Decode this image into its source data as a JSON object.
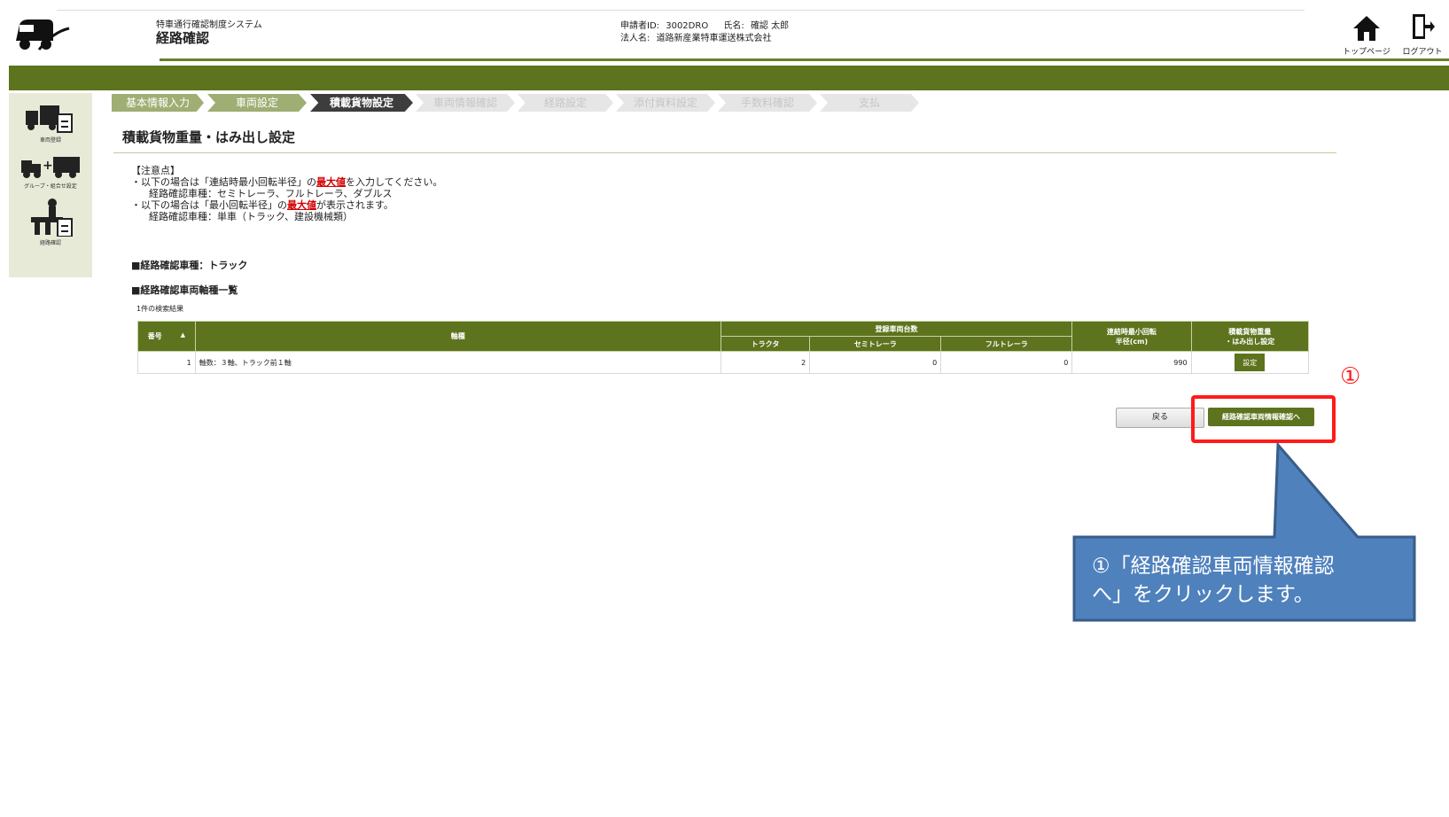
{
  "header": {
    "system_name": "特車通行確認制度システム",
    "page_name": "経路確認",
    "applicant_id_label": "申請者ID:",
    "applicant_id": "3002DRO",
    "name_label": "氏名:",
    "name": "確認 太郎",
    "company_label": "法人名:",
    "company": "道路新産業特車運送株式会社",
    "top_page_label": "トップページ",
    "logout_label": "ログアウト"
  },
  "sidebar": {
    "items": [
      {
        "label": "車両登録"
      },
      {
        "label": "グループ・組合せ設定"
      },
      {
        "label": "経路確認"
      }
    ]
  },
  "steps": [
    {
      "label": "基本情報入力",
      "state": "done"
    },
    {
      "label": "車両設定",
      "state": "done"
    },
    {
      "label": "積載貨物設定",
      "state": "active"
    },
    {
      "label": "車両情報確認",
      "state": "todo"
    },
    {
      "label": "経路設定",
      "state": "todo"
    },
    {
      "label": "添付資料設定",
      "state": "todo"
    },
    {
      "label": "手数料確認",
      "state": "todo"
    },
    {
      "label": "支払",
      "state": "todo"
    }
  ],
  "main": {
    "title": "積載貨物重量・はみ出し設定",
    "notes": {
      "heading": "【注意点】",
      "line1_prefix": "・以下の場合は「連結時最小回転半径」の",
      "line1_highlight": "最大値",
      "line1_suffix": "を入力してください。",
      "line2": "経路確認車種：セミトレーラ、フルトレーラ、ダブルス",
      "line3_prefix": "・以下の場合は「最小回転半径」の",
      "line3_highlight": "最大値",
      "line3_suffix": "が表示されます。",
      "line4": "経路確認車種：単車（トラック、建設機械類）"
    },
    "vehicle_type": "■経路確認車種：トラック",
    "axle_list_title": "■経路確認車両軸種一覧",
    "result_count": "1件の検索結果"
  },
  "table": {
    "headers": {
      "number": "番号",
      "axle_type": "軸種",
      "registered_count": "登録車両台数",
      "tractor": "トラクタ",
      "semi_trailer": "セミトレーラ",
      "full_trailer": "フルトレーラ",
      "radius_line1": "連結時最小回転",
      "radius_line2": "半径(cm)",
      "cargo_line1": "積載貨物重量",
      "cargo_line2": "・はみ出し設定"
    },
    "rows": [
      {
        "number": "1",
        "axle_type": "軸数：３軸、トラック前１軸",
        "tractor": "2",
        "semi_trailer": "0",
        "full_trailer": "0",
        "radius": "990",
        "action": "設定"
      }
    ]
  },
  "buttons": {
    "back": "戻る",
    "next": "経路確認車両情報確認へ"
  },
  "annotation": {
    "marker": "①",
    "callout_line1": "①「経路確認車両情報確認",
    "callout_line2": "へ」をクリックします。"
  },
  "colors": {
    "brand_green": "#5d731d",
    "highlight_red": "#ff1a1a",
    "callout_blue": "#4f81bd"
  }
}
